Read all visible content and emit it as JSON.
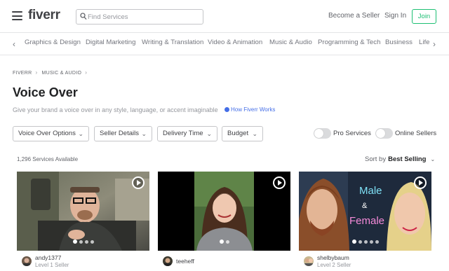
{
  "header": {
    "logo": "fiverr",
    "search_placeholder": "Find Services",
    "become_seller": "Become a Seller",
    "sign_in": "Sign In",
    "join": "Join"
  },
  "categories": [
    "Graphics & Design",
    "Digital Marketing",
    "Writing & Translation",
    "Video & Animation",
    "Music & Audio",
    "Programming & Tech",
    "Business",
    "Life"
  ],
  "breadcrumb": [
    "FIVERR",
    "MUSIC & AUDIO"
  ],
  "page": {
    "title": "Voice Over",
    "subtitle": "Give your brand a voice over in any style, language, or accent imaginable",
    "how_it_works": "How Fiverr Works"
  },
  "filters": [
    "Voice Over Options",
    "Seller Details",
    "Delivery Time",
    "Budget"
  ],
  "toggles": {
    "pro_services": "Pro Services",
    "online_sellers": "Online Sellers"
  },
  "results": {
    "count": "1,296 Services Available",
    "sort_label": "Sort by",
    "sort_value": "Best Selling"
  },
  "gigs": [
    {
      "seller": "andy1377",
      "level": "Level 1 Seller"
    },
    {
      "seller": "teeheff",
      "level": ""
    },
    {
      "seller": "shelbybaum",
      "level": "Level 2 Seller",
      "thumb_text_1": "Male",
      "thumb_text_2": "&",
      "thumb_text_3": "Female"
    }
  ],
  "colors": {
    "brand_green": "#1dbf73",
    "link_blue": "#446ee7",
    "text_dark": "#404145"
  }
}
